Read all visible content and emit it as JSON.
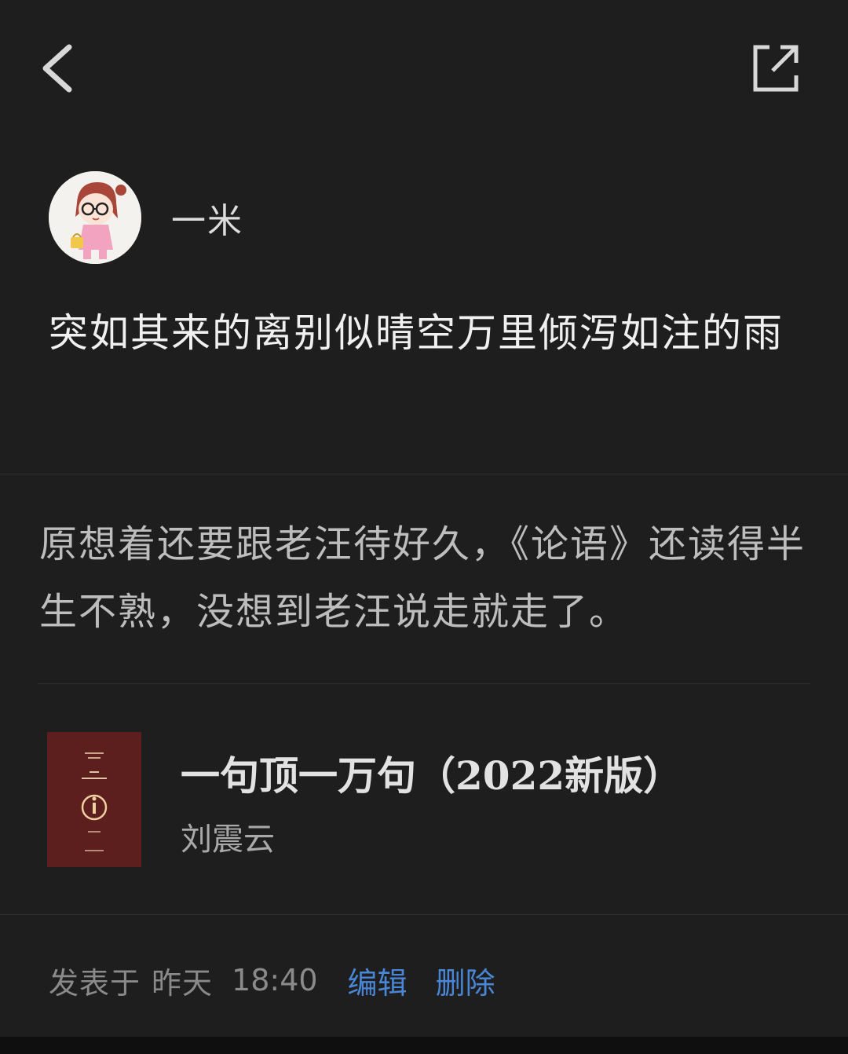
{
  "nav": {
    "back_icon": "chevron-left-icon",
    "share_icon": "external-share-icon"
  },
  "author": {
    "name": "一米",
    "avatar_icon": "cartoon-girl-avatar"
  },
  "post": {
    "title": "突如其来的离别似晴空万里倾泻如注的雨",
    "excerpt": "原想着还要跟老汪待好久，《论语》还读得半生不熟，没想到老汪说走就走了。"
  },
  "book": {
    "title": "一句顶一万句（2022新版）",
    "author": "刘震云",
    "cover_color": "#5c1f1e"
  },
  "footer": {
    "posted_label": "发表于",
    "day": "昨天",
    "time": "18:40",
    "edit_label": "编辑",
    "delete_label": "删除",
    "link_color": "#4a86d6"
  }
}
